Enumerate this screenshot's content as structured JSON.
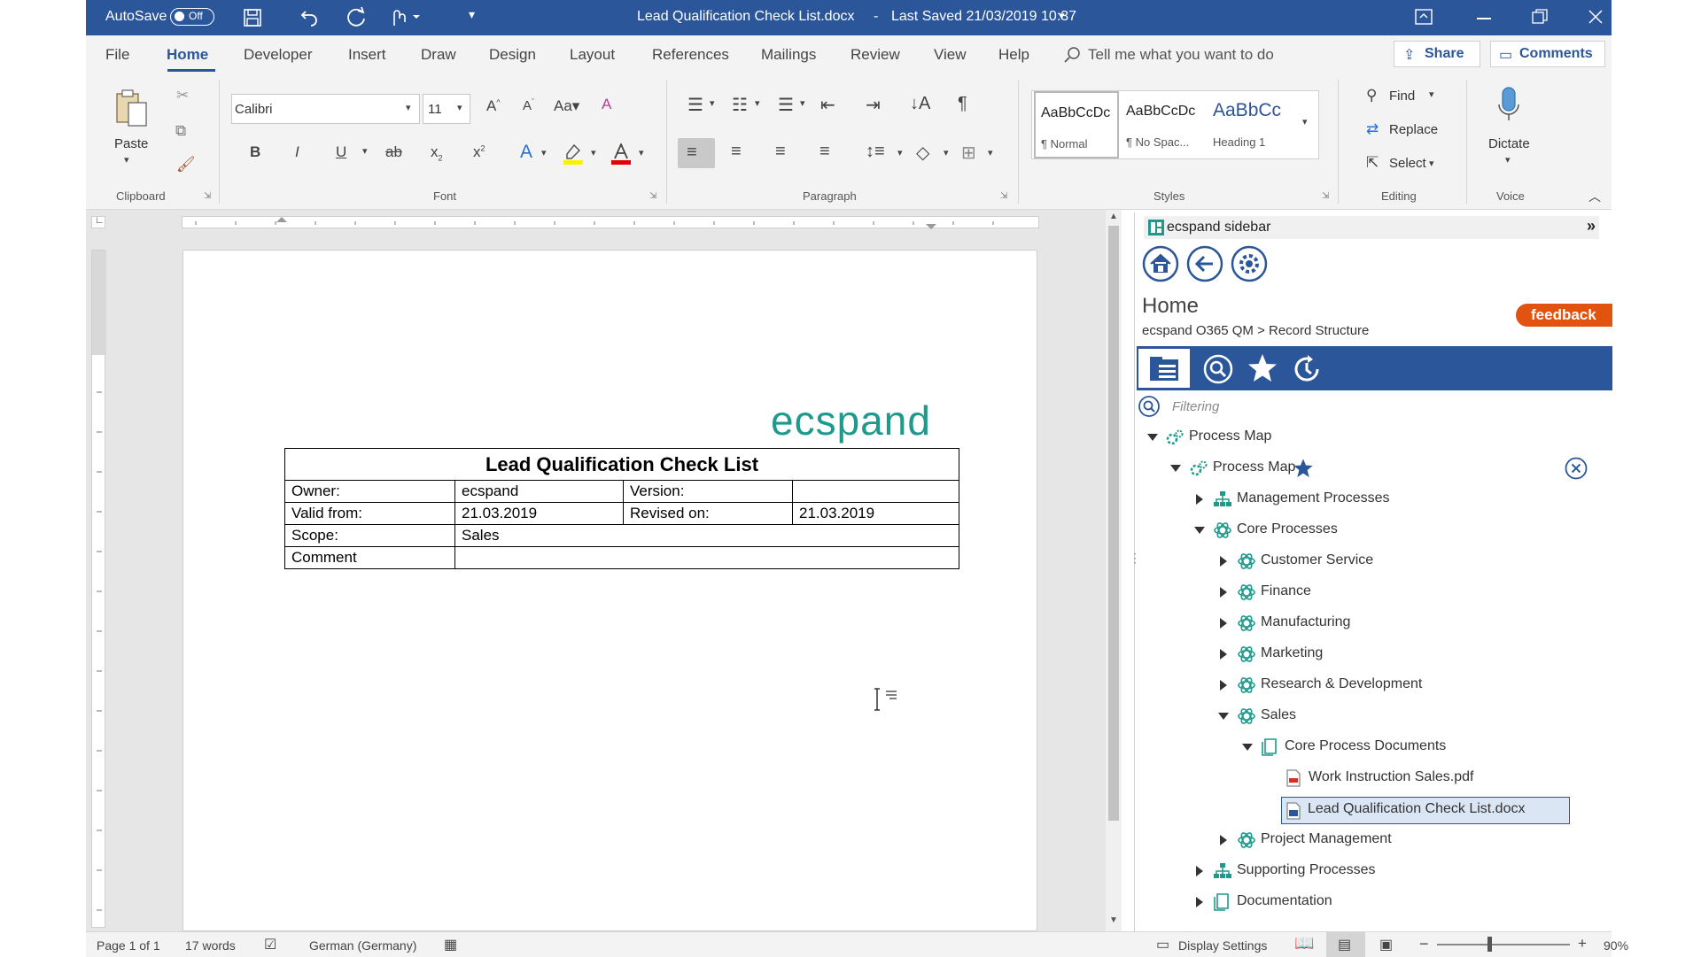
{
  "titlebar": {
    "autosave_label": "AutoSave",
    "autosave_state": "Off",
    "document_title": "Lead Qualification Check List.docx",
    "saved_label": "Last Saved 21/03/2019 10:37"
  },
  "menu": {
    "tabs": [
      "File",
      "Home",
      "Developer",
      "Insert",
      "Draw",
      "Design",
      "Layout",
      "References",
      "Mailings",
      "Review",
      "View",
      "Help"
    ],
    "search_placeholder": "Tell me what you want to do",
    "share_label": "Share",
    "comments_label": "Comments"
  },
  "ribbon": {
    "clipboard": {
      "paste_label": "Paste",
      "group_label": "Clipboard"
    },
    "font": {
      "name": "Calibri",
      "size": "11",
      "group_label": "Font"
    },
    "paragraph": {
      "group_label": "Paragraph"
    },
    "styles": {
      "items": [
        {
          "preview": "AaBbCcDc",
          "name": "¶ Normal"
        },
        {
          "preview": "AaBbCcDc",
          "name": "¶ No Spac..."
        },
        {
          "preview": "AaBbCc",
          "name": "Heading 1"
        }
      ],
      "group_label": "Styles"
    },
    "editing": {
      "find_label": "Find",
      "replace_label": "Replace",
      "select_label": "Select",
      "group_label": "Editing"
    },
    "voice": {
      "dictate_label": "Dictate",
      "group_label": "Voice"
    }
  },
  "document": {
    "logo_text": "ecspand",
    "table": {
      "title": "Lead Qualification Check List",
      "owner_label": "Owner:",
      "owner_value": "ecspand",
      "version_label": "Version:",
      "version_value": "",
      "valid_from_label": "Valid from:",
      "valid_from_value": "21.03.2019",
      "revised_label": "Revised on:",
      "revised_value": "21.03.2019",
      "scope_label": "Scope:",
      "scope_value": "Sales",
      "comment_label": "Comment",
      "comment_value": ""
    }
  },
  "sidebar": {
    "title": "ecspand sidebar",
    "page_title": "Home",
    "breadcrumb": "ecspand O365 QM > Record Structure",
    "feedback_label": "feedback",
    "filter_placeholder": "Filtering",
    "tree": [
      {
        "label": "Process Map"
      },
      {
        "label": "Process Map"
      },
      {
        "label": "Management Processes"
      },
      {
        "label": "Core Processes"
      },
      {
        "label": "Customer Service"
      },
      {
        "label": "Finance"
      },
      {
        "label": "Manufacturing"
      },
      {
        "label": "Marketing"
      },
      {
        "label": "Research & Development"
      },
      {
        "label": "Sales"
      },
      {
        "label": "Core Process Documents"
      },
      {
        "label": "Work Instruction Sales.pdf"
      },
      {
        "label": "Lead Qualification Check List.docx"
      },
      {
        "label": "Project Management"
      },
      {
        "label": "Supporting Processes"
      },
      {
        "label": "Documentation"
      }
    ]
  },
  "statusbar": {
    "page": "Page 1 of 1",
    "words": "17 words",
    "language": "German (Germany)",
    "display_settings": "Display Settings",
    "zoom": "90%"
  },
  "colors": {
    "word_blue": "#2b579a",
    "feedback_orange": "#e2530f",
    "logo_teal": "#1e9a8c"
  }
}
